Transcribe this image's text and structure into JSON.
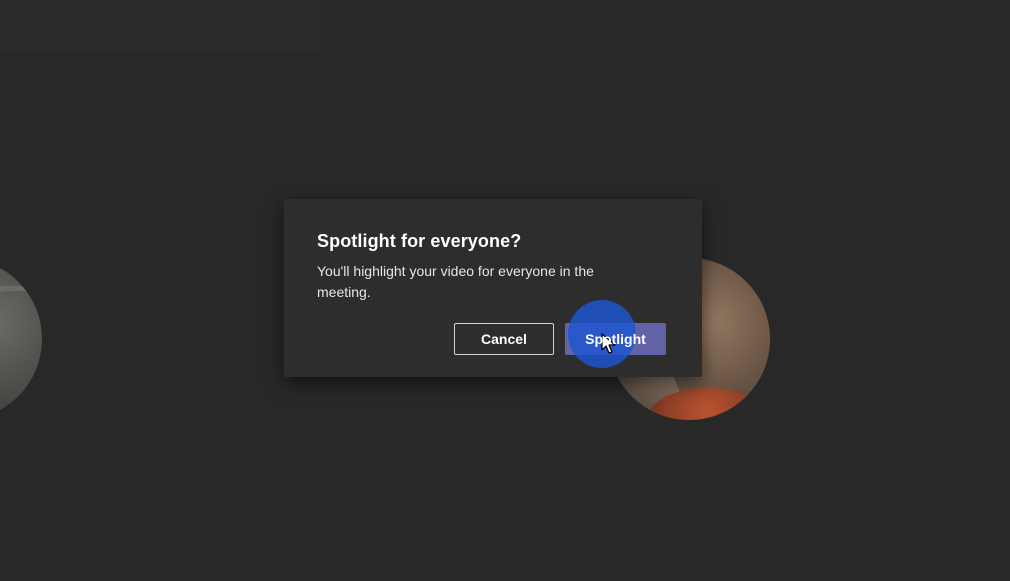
{
  "dialog": {
    "title": "Spotlight for everyone?",
    "body": "You'll highlight your video for everyone in the meeting.",
    "cancel_label": "Cancel",
    "confirm_label": "Spotlight"
  },
  "colors": {
    "background": "#282828",
    "dialog_background": "#2d2d2d",
    "primary_button": "#6264a7",
    "click_highlight": "#1c56d2",
    "text_primary": "#ffffff"
  },
  "icons": {
    "cursor": "mouse-pointer-icon"
  }
}
